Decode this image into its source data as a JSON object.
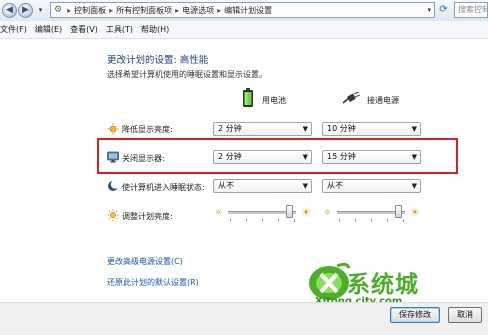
{
  "address": {
    "crumbs": [
      "控制面板",
      "所有控制面板项",
      "电源选项",
      "编辑计划设置"
    ],
    "search_placeholder": "搜索控制面板"
  },
  "menu": [
    "文件(F)",
    "编辑(E)",
    "查看(V)",
    "工具(T)",
    "帮助(H)"
  ],
  "page": {
    "title": "更改计划的设置: 高性能",
    "subtitle": "选择希望计算机使用的睡眠设置和显示设置。"
  },
  "columns": {
    "battery_label": "用电池",
    "plugged_label": "接通电源"
  },
  "rows": [
    {
      "label": "降低显示亮度:",
      "icon": "dim-display-icon",
      "battery": "2 分钟",
      "plugged": "10 分钟"
    },
    {
      "label": "关闭显示器:",
      "icon": "monitor-off-icon",
      "battery": "2 分钟",
      "plugged": "15 分钟"
    },
    {
      "label": "使计算机进入睡眠状态:",
      "icon": "sleep-moon-icon",
      "battery": "从不",
      "plugged": "从不"
    }
  ],
  "brightness": {
    "label": "调整计划亮度:",
    "battery_level": 0.95,
    "plugged_level": 0.95
  },
  "links": {
    "advanced": "更改高级电源设置(C)",
    "restore": "还原此计划的默认设置(R)"
  },
  "buttons": {
    "save": "保存修改",
    "cancel": "取消"
  },
  "watermark": {
    "text_cn": "系统城",
    "text_en": "Xitong city.com"
  },
  "colors": {
    "title_blue": "#1e3f8a",
    "link_blue": "#1a56b3",
    "highlight_red": "#d9211f",
    "watermark_green": "#4caf2a"
  }
}
